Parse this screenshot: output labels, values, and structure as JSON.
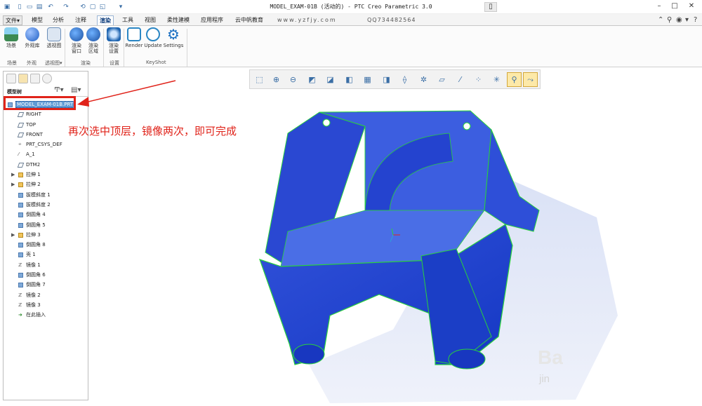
{
  "window": {
    "title": "MODEL_EXAM-01B (活动的) - PTC Creo Parametric 3.0"
  },
  "tabs": [
    {
      "label": "文件▾"
    },
    {
      "label": "模型"
    },
    {
      "label": "分析"
    },
    {
      "label": "注释"
    },
    {
      "label": "渲染"
    },
    {
      "label": "工具"
    },
    {
      "label": "视图"
    },
    {
      "label": "柔性建模"
    },
    {
      "label": "应用程序"
    },
    {
      "label": "云中帆教育"
    },
    {
      "label": "www.yzfjy.com"
    },
    {
      "label": "QQ734482564"
    }
  ],
  "ribbon": {
    "buttons": [
      {
        "label": "场景",
        "icon": "scene-icon",
        "color": "#3c8a52"
      },
      {
        "label": "外观库",
        "icon": "appearance-gallery-icon",
        "color": "#1f5fc4"
      },
      {
        "label": "透视图",
        "icon": "perspective-icon",
        "color": "#6c8fb8"
      },
      {
        "label": "渲染窗口",
        "icon": "render-window-icon",
        "color": "#2f71c8"
      },
      {
        "label": "渲染区域",
        "icon": "render-region-icon",
        "color": "#2f71c8"
      },
      {
        "label": "渲染设置",
        "icon": "render-setup-icon",
        "color": "#1e64b0"
      },
      {
        "label": "Render",
        "icon": "keyshot-render-icon",
        "color": "#2a86c4"
      },
      {
        "label": "Update",
        "icon": "keyshot-update-icon",
        "color": "#2a86c4"
      },
      {
        "label": "Settings",
        "icon": "gear-icon",
        "color": "#1a6fc2"
      }
    ],
    "groups": [
      {
        "label": "场景"
      },
      {
        "label": "外观"
      },
      {
        "label": "透视图▾"
      },
      {
        "label": "渲染"
      },
      {
        "label": "设置"
      },
      {
        "label": "KeyShot"
      }
    ]
  },
  "model_tree": {
    "header": "模型树",
    "items": [
      {
        "label": "MODEL_EXAM-01B.PRT",
        "kind": "root"
      },
      {
        "label": "RIGHT",
        "kind": "plane"
      },
      {
        "label": "TOP",
        "kind": "plane"
      },
      {
        "label": "FRONT",
        "kind": "plane"
      },
      {
        "label": "PRT_CSYS_DEF",
        "kind": "csys"
      },
      {
        "label": "A_1",
        "kind": "axis"
      },
      {
        "label": "DTM2",
        "kind": "plane"
      },
      {
        "label": "拉伸 1",
        "kind": "feature",
        "expandable": true
      },
      {
        "label": "拉伸 2",
        "kind": "feature",
        "expandable": true
      },
      {
        "label": "拔模斜度 1",
        "kind": "feature"
      },
      {
        "label": "拔模斜度 2",
        "kind": "feature"
      },
      {
        "label": "倒圆角 4",
        "kind": "feature"
      },
      {
        "label": "倒圆角 5",
        "kind": "feature"
      },
      {
        "label": "拉伸 3",
        "kind": "feature",
        "expandable": true
      },
      {
        "label": "倒圆角 8",
        "kind": "feature"
      },
      {
        "label": "壳 1",
        "kind": "feature"
      },
      {
        "label": "镜像 1",
        "kind": "feature"
      },
      {
        "label": "倒圆角 6",
        "kind": "feature"
      },
      {
        "label": "倒圆角 7",
        "kind": "feature"
      },
      {
        "label": "镜像 2",
        "kind": "feature"
      },
      {
        "label": "镜像 3",
        "kind": "feature"
      },
      {
        "label": "在此插入",
        "kind": "insert"
      }
    ]
  },
  "annotation": {
    "text": "再次选中顶层，镜像两次，即可完成",
    "color": "#e0231a"
  },
  "watermark": {
    "logo": "Ba",
    "sub": "jin"
  },
  "colors": {
    "accent": "#1f4fd6",
    "highlight": "#e0231a",
    "edge": "#29d23b"
  }
}
